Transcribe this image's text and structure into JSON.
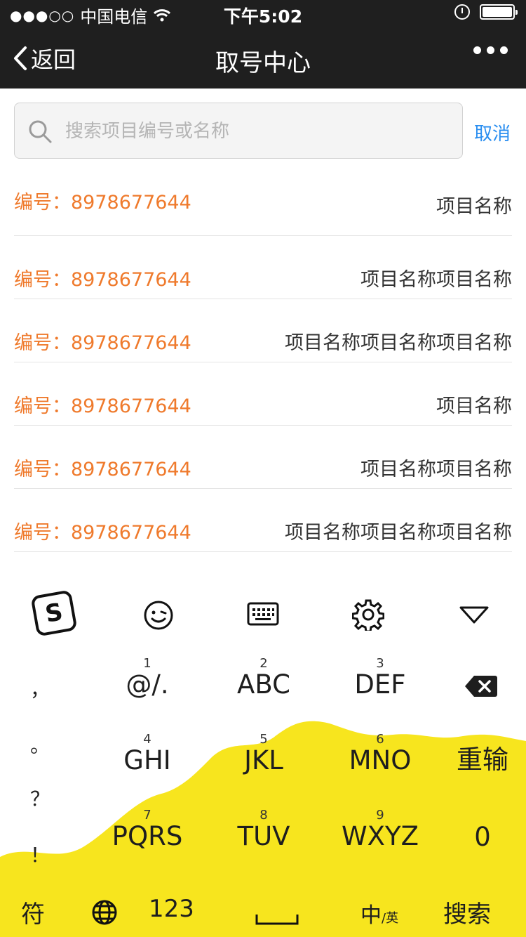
{
  "status_bar": {
    "signal": "●●●○○",
    "carrier": "中国电信",
    "time": "下午5:02"
  },
  "nav": {
    "back_label": "返回",
    "title": "取号中心"
  },
  "search": {
    "placeholder": "搜索项目编号或名称",
    "value": "",
    "cancel_label": "取消"
  },
  "list": [
    {
      "code_label": "编号：8978677644",
      "name": "项目名称"
    },
    {
      "code_label": "编号：8978677644",
      "name": "项目名称项目名称"
    },
    {
      "code_label": "编号：8978677644",
      "name": "项目名称项目名称项目名称"
    },
    {
      "code_label": "编号：8978677644",
      "name": "项目名称"
    },
    {
      "code_label": "编号：8978677644",
      "name": "项目名称项目名称"
    },
    {
      "code_label": "编号：8978677644",
      "name": "项目名称项目名称项目名称"
    }
  ],
  "keyboard": {
    "punctuation": [
      "，",
      "。",
      "？",
      "！"
    ],
    "keys": [
      {
        "num": "1",
        "letters": "@/."
      },
      {
        "num": "2",
        "letters": "ABC"
      },
      {
        "num": "3",
        "letters": "DEF"
      },
      {
        "num": "4",
        "letters": "GHI"
      },
      {
        "num": "5",
        "letters": "JKL"
      },
      {
        "num": "6",
        "letters": "MNO"
      },
      {
        "num": "7",
        "letters": "PQRS"
      },
      {
        "num": "8",
        "letters": "TUV"
      },
      {
        "num": "9",
        "letters": "WXYZ"
      }
    ],
    "reenter_label": "重输",
    "zero_label": "0",
    "symbol_label": "符",
    "num_label": "123",
    "lang_main": "中",
    "lang_sub": "/英",
    "search_label": "搜索",
    "splash_color": "#f7e51e",
    "accent_color": "#ef7a2c"
  }
}
